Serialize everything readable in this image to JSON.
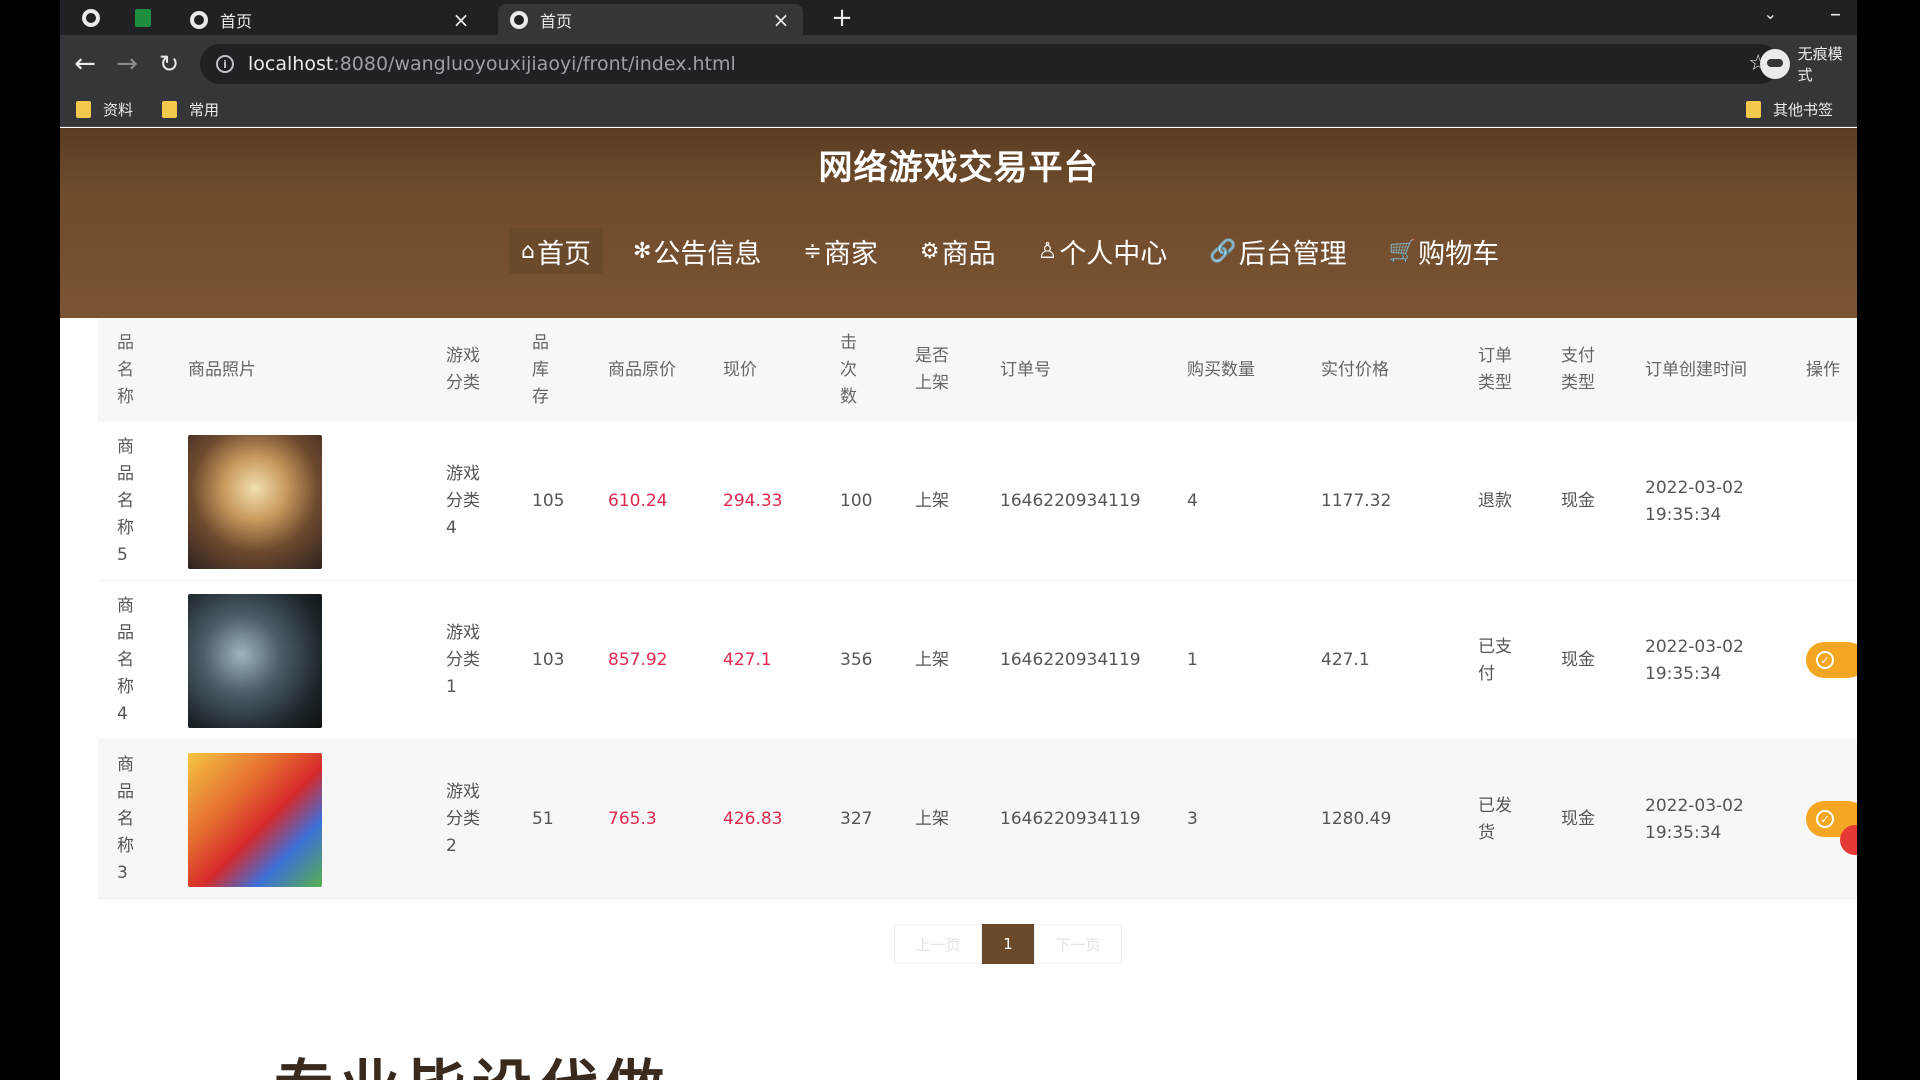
{
  "browser": {
    "tabs": [
      {
        "title": "首页",
        "close": "×"
      },
      {
        "title": "首页",
        "close": "×"
      }
    ],
    "new_tab": "+",
    "url_host": "localhost",
    "url_rest": ":8080/wangluoyouxijiaoyi/front/index.html",
    "profile_label": "无痕模式",
    "bookmarks": [
      "资料",
      "常用"
    ],
    "other_bookmarks": "其他书签"
  },
  "site": {
    "title": "网络游戏交易平台",
    "nav": [
      {
        "icon": "⌂",
        "label": "首页"
      },
      {
        "icon": "✻",
        "label": "公告信息"
      },
      {
        "icon": "≑",
        "label": "商家"
      },
      {
        "icon": "⚙",
        "label": "商品"
      },
      {
        "icon": "♙",
        "label": "个人中心"
      },
      {
        "icon": "🔗",
        "label": "后台管理"
      },
      {
        "icon": "🛒",
        "label": "购物车"
      }
    ]
  },
  "table": {
    "headers": {
      "name": "品名称",
      "photo": "商品照片",
      "category": "游戏分类",
      "stock": "品库存",
      "orig_price": "商品原价",
      "price": "现价",
      "clicks": "击次数",
      "listed": "是否上架",
      "order_no": "订单号",
      "qty": "购买数量",
      "paid": "实付价格",
      "order_type": "订单类型",
      "pay_type": "支付类型",
      "created": "订单创建时间",
      "op": "操作"
    },
    "rows": [
      {
        "name": "商品名称5",
        "category": "游戏分类4",
        "stock": "105",
        "orig_price": "610.24",
        "price": "294.33",
        "clicks": "100",
        "listed": "上架",
        "order_no": "1646220934119",
        "qty": "4",
        "paid": "1177.32",
        "order_type": "退款",
        "pay_type": "现金",
        "date": "2022-03-02",
        "time": "19:35:34"
      },
      {
        "name": "商品名称4",
        "category": "游戏分类1",
        "stock": "103",
        "orig_price": "857.92",
        "price": "427.1",
        "clicks": "356",
        "listed": "上架",
        "order_no": "1646220934119",
        "qty": "1",
        "paid": "427.1",
        "order_type": "已支付",
        "pay_type": "现金",
        "date": "2022-03-02",
        "time": "19:35:34"
      },
      {
        "name": "商品名称3",
        "category": "游戏分类2",
        "stock": "51",
        "orig_price": "765.3",
        "price": "426.83",
        "clicks": "327",
        "listed": "上架",
        "order_no": "1646220934119",
        "qty": "3",
        "paid": "1280.49",
        "order_type": "已发货",
        "pay_type": "现金",
        "date": "2022-03-02",
        "time": "19:35:34"
      }
    ]
  },
  "pager": {
    "prev": "上一页",
    "current": "1",
    "next": "下一页"
  },
  "promo_text": "专业毕设代做",
  "colors": {
    "header_brown": "#6e4b2c",
    "accent_brown": "#6b4a2c",
    "price_red": "#e0284f",
    "action_orange": "#f5a623"
  }
}
